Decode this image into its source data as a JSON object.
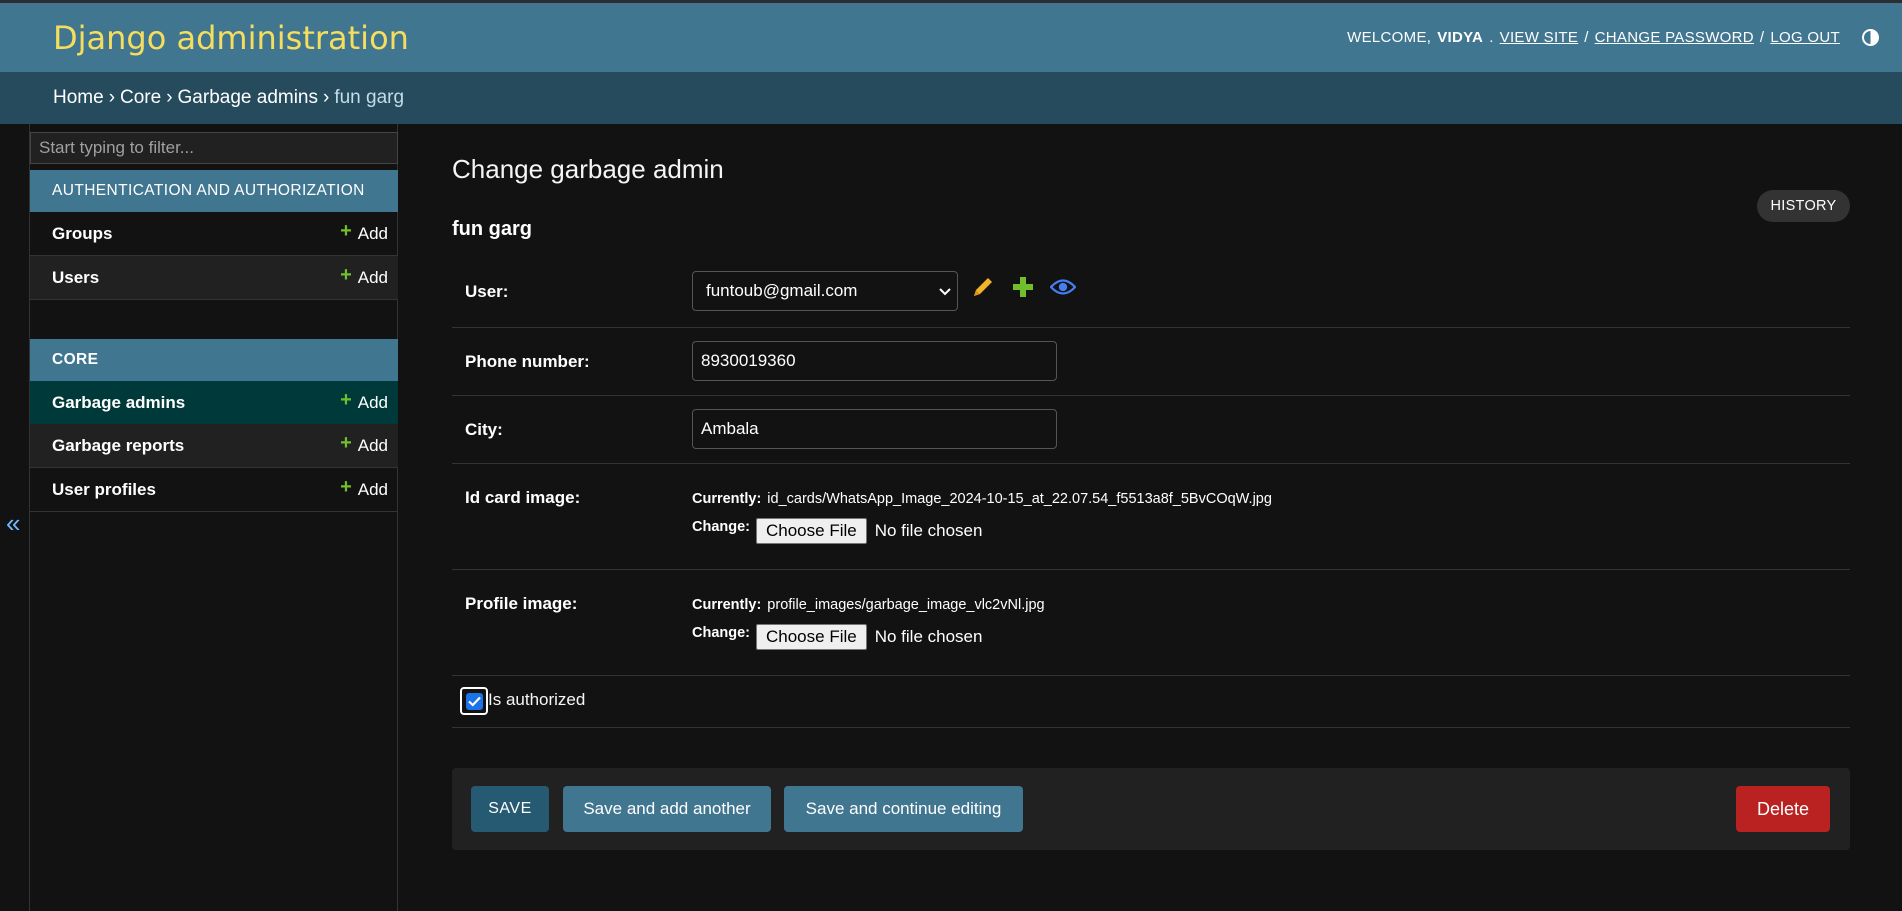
{
  "header": {
    "brand": "Django administration",
    "welcome": "WELCOME,",
    "username": "VIDYA",
    "view_site": "VIEW SITE",
    "change_password": "CHANGE PASSWORD",
    "log_out": "LOG OUT",
    "separator": "/"
  },
  "breadcrumbs": {
    "home": "Home",
    "app": "Core",
    "model": "Garbage admins",
    "current": "fun garg",
    "sep": "›"
  },
  "sidebar": {
    "filter_placeholder": "Start typing to filter...",
    "collapse_glyph": "«",
    "modules": [
      {
        "title": "AUTHENTICATION AND AUTHORIZATION",
        "models": [
          {
            "name": "Groups",
            "add": "Add"
          },
          {
            "name": "Users",
            "add": "Add"
          }
        ]
      },
      {
        "title": "CORE",
        "models": [
          {
            "name": "Garbage admins",
            "add": "Add"
          },
          {
            "name": "Garbage reports",
            "add": "Add"
          },
          {
            "name": "User profiles",
            "add": "Add"
          }
        ]
      }
    ]
  },
  "main": {
    "title": "Change garbage admin",
    "history": "HISTORY",
    "object_name": "fun garg",
    "fields": {
      "user": {
        "label": "User:",
        "value": "funtoub@gmail.com"
      },
      "phone": {
        "label": "Phone number:",
        "value": "8930019360"
      },
      "city": {
        "label": "City:",
        "value": "Ambala"
      },
      "id_card": {
        "label": "Id card image:",
        "currently_label": "Currently:",
        "currently_value": "id_cards/WhatsApp_Image_2024-10-15_at_22.07.54_f5513a8f_5BvCOqW.jpg",
        "change_label": "Change:",
        "choose": "Choose File",
        "no_file": "No file chosen"
      },
      "profile": {
        "label": "Profile image:",
        "currently_label": "Currently:",
        "currently_value": "profile_images/garbage_image_vlc2vNl.jpg",
        "change_label": "Change:",
        "choose": "Choose File",
        "no_file": "No file chosen"
      },
      "authorized": {
        "label": "Is authorized",
        "checked": true
      }
    },
    "buttons": {
      "save": "SAVE",
      "save_add": "Save and add another",
      "save_continue": "Save and continue editing",
      "delete": "Delete"
    }
  },
  "colors": {
    "header_bg": "#417690",
    "breadcrumb_bg": "#264b5d",
    "brand": "#f5dd5d",
    "add_green": "#70bf2b",
    "delete_red": "#ba2121",
    "active_row": "#003939"
  },
  "icons": [
    "pencil-icon",
    "plus-icon",
    "eye-icon",
    "theme-toggle-icon",
    "chevron-down-icon"
  ]
}
